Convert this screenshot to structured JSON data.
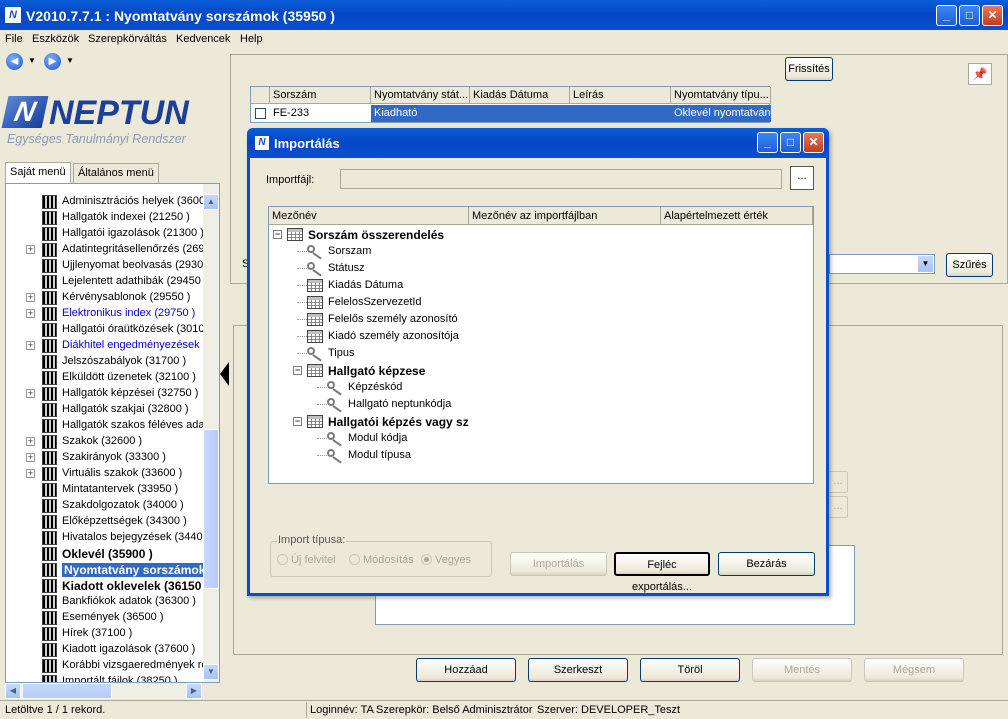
{
  "window": {
    "title": "V2010.7.7.1 : Nyomtatvány sorszámok (35950  )",
    "minimize": "_",
    "maximize": "□",
    "close": "✕"
  },
  "menu": [
    "File",
    "Eszközök",
    "Szerepkörváltás",
    "Kedvencek",
    "Help"
  ],
  "logo": {
    "word": "NEPTUN",
    "letter": "N",
    "tagline": "Egységes Tanulmányi Rendszer"
  },
  "left_tabs": [
    "Saját menü",
    "Általános menü"
  ],
  "tree_items": [
    {
      "label": "Adminisztrációs helyek (3600",
      "exp": false,
      "style": "normal"
    },
    {
      "label": "Hallgatók indexei (21250  )",
      "exp": false,
      "style": "normal"
    },
    {
      "label": "Hallgatói igazolások (21300  )",
      "exp": false,
      "style": "normal"
    },
    {
      "label": "Adatintegritásellenőrzés (2695",
      "exp": true,
      "style": "normal"
    },
    {
      "label": "Ujjlenyomat beolvasás (29300",
      "exp": false,
      "style": "normal"
    },
    {
      "label": "Lejelentett adathibák (29450",
      "exp": false,
      "style": "normal"
    },
    {
      "label": "Kérvénysablonok (29550  )",
      "exp": true,
      "style": "normal"
    },
    {
      "label": "Elektronikus index (29750  )",
      "exp": true,
      "style": "link"
    },
    {
      "label": "Hallgatói óraütközések (3010",
      "exp": false,
      "style": "normal"
    },
    {
      "label": "Diákhitel engedményezések (",
      "exp": true,
      "style": "link"
    },
    {
      "label": "Jelszószabályok (31700  )",
      "exp": false,
      "style": "normal"
    },
    {
      "label": "Elküldött üzenetek (32100  )",
      "exp": false,
      "style": "normal"
    },
    {
      "label": "Hallgatók képzései (32750  )",
      "exp": true,
      "style": "normal"
    },
    {
      "label": "Hallgatók szakjai (32800  )",
      "exp": false,
      "style": "normal"
    },
    {
      "label": "Hallgatók szakos féléves ada",
      "exp": false,
      "style": "normal"
    },
    {
      "label": "Szakok (32600  )",
      "exp": true,
      "style": "normal"
    },
    {
      "label": "Szakirányok (33300  )",
      "exp": true,
      "style": "normal"
    },
    {
      "label": "Virtuális szakok (33600  )",
      "exp": true,
      "style": "normal"
    },
    {
      "label": "Mintatantervek (33950  )",
      "exp": false,
      "style": "normal"
    },
    {
      "label": "Szakdolgozatok (34000  )",
      "exp": false,
      "style": "normal"
    },
    {
      "label": "Előképzettségek (34300  )",
      "exp": false,
      "style": "normal"
    },
    {
      "label": "Hivatalos bejegyzések (34400",
      "exp": false,
      "style": "normal"
    },
    {
      "label": "Oklevél (35900  )",
      "exp": false,
      "style": "bold"
    },
    {
      "label": "Nyomtatvány sorszámok",
      "exp": false,
      "style": "sel"
    },
    {
      "label": "Kiadott oklevelek (36150",
      "exp": false,
      "style": "bold"
    },
    {
      "label": "Bankfiókok adatok (36300  )",
      "exp": false,
      "style": "normal"
    },
    {
      "label": "Események (36500  )",
      "exp": false,
      "style": "normal"
    },
    {
      "label": "Hírek (37100  )",
      "exp": false,
      "style": "normal"
    },
    {
      "label": "Kiadott igazolások (37600  )",
      "exp": false,
      "style": "normal"
    },
    {
      "label": "Korábbi vizsgaeredmények rö",
      "exp": false,
      "style": "normal"
    },
    {
      "label": "Importált fájlok (38250  )",
      "exp": false,
      "style": "normal"
    }
  ],
  "grid": {
    "headers": [
      "Sorszám",
      "Nyomtatvány stát...",
      "Kiadás Dátuma",
      "Leírás",
      "Nyomtatvány típu..."
    ],
    "rows": [
      [
        "FE-233",
        "Kiadható",
        "",
        "",
        "Oklevél nyomtatvány"
      ]
    ]
  },
  "buttons": {
    "refresh": "Frissítés",
    "filter": "Szűrés",
    "add": "Hozzáad",
    "edit": "Szerkeszt",
    "delete": "Töröl",
    "save": "Mentés",
    "cancel": "Mégsem",
    "side_dots": "..."
  },
  "filter_label": "S",
  "statusbar": {
    "records": "Letöltve 1 / 1 rekord.",
    "login": "Loginnév: TA",
    "role": "Szerepkör: Belső Adminisztrátor",
    "server": "Szerver: DEVELOPER_Teszt"
  },
  "dialog": {
    "title": "Importálás",
    "file_label": "Importfájl:",
    "browse": "...",
    "columns": [
      "Mezőnév",
      "Mezőnév az importfájlban",
      "Alapértelmezett érték"
    ],
    "rows": [
      {
        "label": "Sorszám összerendelés",
        "kind": "group",
        "level": 0
      },
      {
        "label": "Sorszam",
        "kind": "field",
        "level": 1
      },
      {
        "label": "Státusz",
        "kind": "field",
        "level": 1
      },
      {
        "label": "Kiadás Dátuma",
        "kind": "table",
        "level": 1
      },
      {
        "label": "FelelosSzervezetId",
        "kind": "table",
        "level": 1
      },
      {
        "label": "Felelős személy azonosító",
        "kind": "table",
        "level": 1
      },
      {
        "label": "Kiadó személy azonosítója",
        "kind": "table",
        "level": 1
      },
      {
        "label": "Tipus",
        "kind": "field",
        "level": 1
      },
      {
        "label": "Hallgató képzese",
        "kind": "group",
        "level": 1
      },
      {
        "label": "Képzéskód",
        "kind": "field",
        "level": 2
      },
      {
        "label": "Hallgató neptunkódja",
        "kind": "field",
        "level": 2
      },
      {
        "label": "Hallgatói képzés vagy sz",
        "kind": "group",
        "level": 1
      },
      {
        "label": "Modul kódja",
        "kind": "field",
        "level": 2
      },
      {
        "label": "Modul típusa",
        "kind": "field",
        "level": 2
      }
    ],
    "import_type": {
      "legend": "Import típusa:",
      "options": [
        "Új felvitel",
        "Módosítás",
        "Vegyes"
      ],
      "selected": "Vegyes"
    },
    "btn_import": "Importálás",
    "btn_export_header": "Fejléc exportálás...",
    "btn_close": "Bezárás"
  }
}
